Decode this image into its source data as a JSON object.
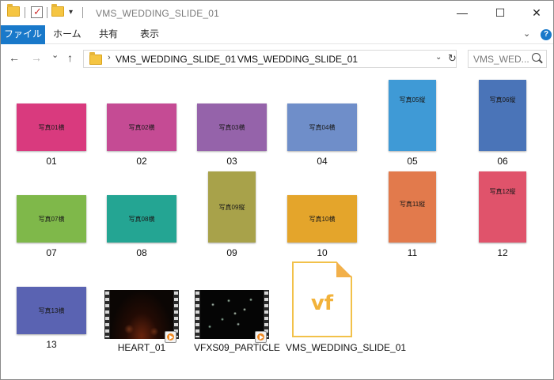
{
  "window": {
    "title": "VMS_WEDDING_SLIDE_01",
    "minimize": "—",
    "maximize": "☐",
    "close": "✕"
  },
  "ribbon": {
    "tabs": [
      "ファイル",
      "ホーム",
      "共有",
      "表示"
    ],
    "accent": "#1979ca"
  },
  "nav": {
    "back": "←",
    "forward": "→",
    "recent": "⌄",
    "up": "↑",
    "breadcrumbs": [
      "VMS_WEDDING_SLIDE_01",
      "VMS_WEDDING_SLIDE_01"
    ],
    "search_placeholder": "VMS_WED..."
  },
  "files": [
    {
      "name": "01",
      "thumb": "写真01横",
      "color": "#d93a7e"
    },
    {
      "name": "02",
      "thumb": "写真02横",
      "color": "#c54b94"
    },
    {
      "name": "03",
      "thumb": "写真03横",
      "color": "#9563aa"
    },
    {
      "name": "04",
      "thumb": "写真04横",
      "color": "#6f8ec9"
    },
    {
      "name": "05",
      "thumb": "写真05縦",
      "color": "#3f9ad6"
    },
    {
      "name": "06",
      "thumb": "写真06縦",
      "color": "#4a74b8"
    },
    {
      "name": "07",
      "thumb": "写真07横",
      "color": "#7fb84a"
    },
    {
      "name": "08",
      "thumb": "写真08横",
      "color": "#24a593"
    },
    {
      "name": "09",
      "thumb": "写真09縦",
      "color": "#a8a24a"
    },
    {
      "name": "10",
      "thumb": "写真10横",
      "color": "#e4a52b"
    },
    {
      "name": "11",
      "thumb": "写真11縦",
      "color": "#e27a4c"
    },
    {
      "name": "12",
      "thumb": "写真12縦",
      "color": "#e0536b"
    },
    {
      "name": "13",
      "thumb": "写真13横",
      "color": "#5a63b2"
    },
    {
      "name": "HEART_01"
    },
    {
      "name": "VFXS09_PARTICLE"
    },
    {
      "name": "VMS_WEDDING_SLIDE_01",
      "icon_text": "vf"
    }
  ]
}
